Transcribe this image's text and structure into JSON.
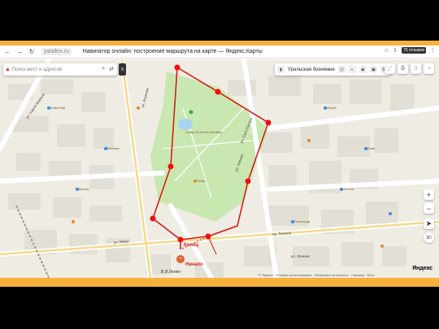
{
  "browser": {
    "url": "yandex.ru",
    "title": "Навигатор онлайн: построение маршрута на карте — Яндекс.Карты",
    "reviews": "75 отзывов"
  },
  "search": {
    "placeholder": "Поиск мест и адресов"
  },
  "toolbar": {
    "place_label": "Уральская бизнмане"
  },
  "zoom": {
    "plus": "+",
    "minus": "−",
    "level": "3D"
  },
  "route": {
    "start_label": "Начало",
    "end_label": "Конец"
  },
  "streets": {
    "karla_marksa": "ул. Карла Маркса",
    "mira": "ул. Мира",
    "kirova": "ул. Кирова",
    "lenina": "пр. Ленина",
    "lenina2": "ул. Ленина",
    "sukhe": "ул. Сухэ-Батора",
    "akhunova": "ул. Ахунова",
    "metro": "В.И.Ленин"
  },
  "pois": {
    "square": "Сквер 50-летия Октября",
    "cafe": "Кафе-бар",
    "museum": "Музей",
    "shop": "Магазин",
    "bank": "Банк",
    "hotel": "Гостиница",
    "theater": "Театр",
    "school": "Школа",
    "pharmacy": "Аптека"
  },
  "footer": {
    "text": "© Яндекс · Условия использования · Исправить неточность · Справка · Фото",
    "brand": "Яндекс"
  },
  "colors": {
    "route": "#d11",
    "park": "#c9e7b0",
    "road": "#ffffff",
    "building": "#e2dfd6",
    "frame": "#f6b23c"
  }
}
